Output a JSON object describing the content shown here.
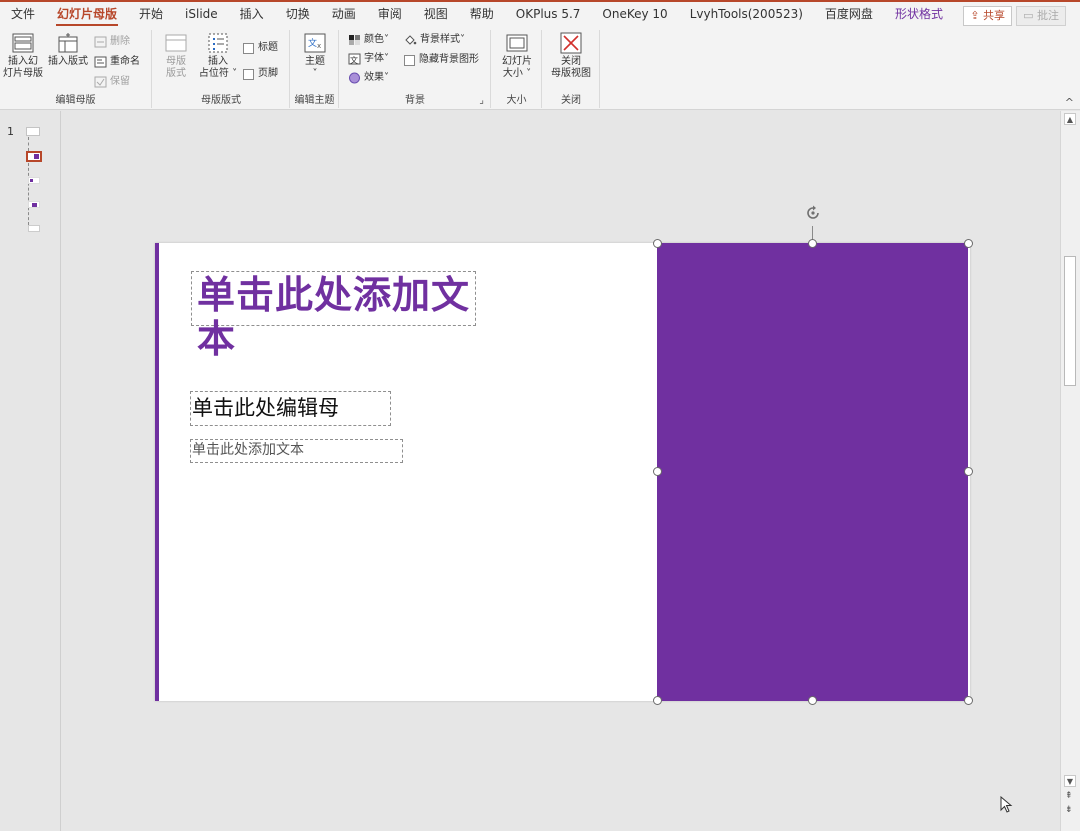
{
  "menu": {
    "tabs": [
      {
        "label": "文件"
      },
      {
        "label": "幻灯片母版"
      },
      {
        "label": "开始"
      },
      {
        "label": "iSlide"
      },
      {
        "label": "插入"
      },
      {
        "label": "切换"
      },
      {
        "label": "动画"
      },
      {
        "label": "审阅"
      },
      {
        "label": "视图"
      },
      {
        "label": "帮助"
      },
      {
        "label": "OKPlus 5.7"
      },
      {
        "label": "OneKey 10"
      },
      {
        "label": "LvyhTools(200523)"
      },
      {
        "label": "百度网盘"
      },
      {
        "label": "形状格式"
      }
    ],
    "active_tab": "幻灯片母版",
    "share_label": "共享",
    "comment_label": "批注"
  },
  "ribbon": {
    "edit_master": {
      "label": "编辑母版",
      "insert_slide_master_line1": "插入幻",
      "insert_slide_master_line2": "灯片母版",
      "insert_layout": "插入版式",
      "delete": "删除",
      "rename": "重命名",
      "preserve": "保留"
    },
    "master_layout": {
      "label": "母版版式",
      "master_layout_line1": "母版",
      "master_layout_line2": "版式",
      "insert_placeholder_line1": "插入",
      "insert_placeholder_line2": "占位符",
      "title_checkbox": "标题",
      "footer_checkbox": "页脚"
    },
    "edit_theme": {
      "label": "编辑主题",
      "themes": "主题"
    },
    "background": {
      "label": "背景",
      "colors": "颜色",
      "fonts": "字体",
      "effects": "效果",
      "background_styles": "背景样式",
      "hide_background_graphics": "隐藏背景图形"
    },
    "size": {
      "label": "大小",
      "slide_size_line1": "幻灯片",
      "slide_size_line2": "大小"
    },
    "close": {
      "label": "关闭",
      "close_master_line1": "关闭",
      "close_master_line2": "母版视图"
    }
  },
  "thumbnails": {
    "slide_number": "1"
  },
  "slide": {
    "title": "单击此处添加文本",
    "subtitle": "单击此处编辑母",
    "body": "单击此处添加文本"
  },
  "colors": {
    "accent": "#7030a0",
    "brand": "#b7472a"
  }
}
